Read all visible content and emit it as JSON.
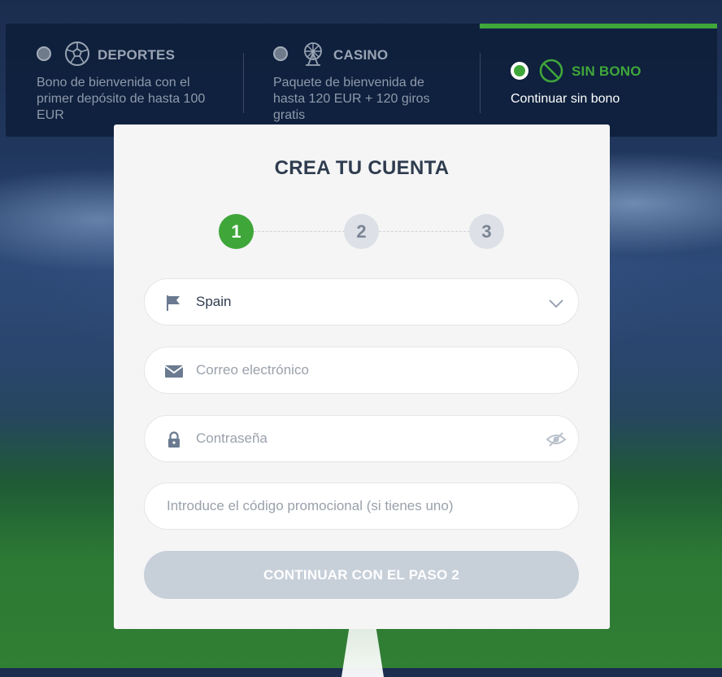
{
  "bonus": {
    "options": [
      {
        "title": "DEPORTES",
        "description": "Bono de bienvenida con el primer depósito de hasta 100 EUR",
        "icon": "soccer-ball-icon",
        "selected": false
      },
      {
        "title": "CASINO",
        "description": "Paquete de bienvenida de hasta 120 EUR + 120 giros gratis",
        "icon": "ferris-wheel-icon",
        "selected": false
      },
      {
        "title": "SIN BONO",
        "description": "Continuar sin bono",
        "icon": "no-bonus-icon",
        "selected": true
      }
    ]
  },
  "form": {
    "title": "CREA TU CUENTA",
    "steps": [
      "1",
      "2",
      "3"
    ],
    "active_step": "1",
    "country": {
      "value": "Spain",
      "icon": "flag-icon"
    },
    "email": {
      "placeholder": "Correo electrónico",
      "icon": "envelope-icon"
    },
    "password": {
      "placeholder": "Contraseña",
      "icon": "lock-icon",
      "toggle_icon": "eye-slash-icon"
    },
    "promo": {
      "placeholder": "Introduce el código promocional (si tienes uno)"
    },
    "submit_label": "CONTINUAR CON EL PASO 2"
  },
  "colors": {
    "accent": "#3fa63a",
    "header_bg": "#0e203c",
    "button_disabled": "#c7cfd9"
  }
}
